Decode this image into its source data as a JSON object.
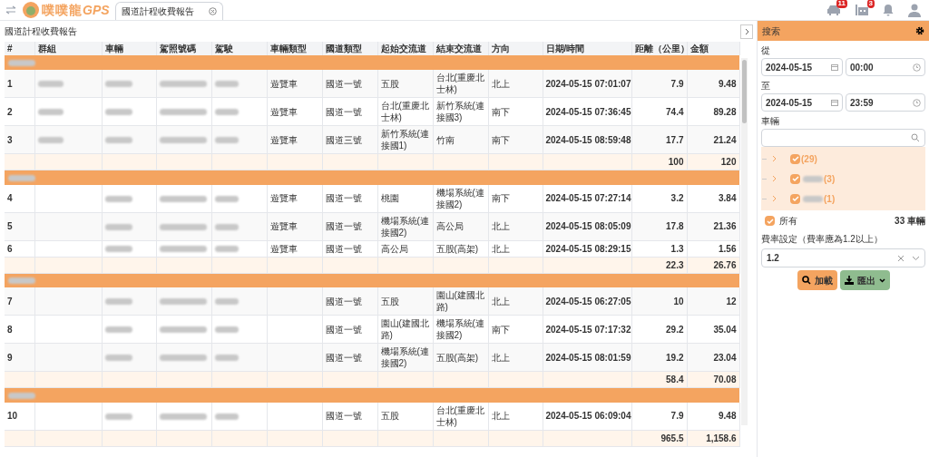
{
  "top_bar": {
    "brand": "噗噗龍",
    "brand_suffix": "GPS",
    "tabs": [
      {
        "label": "國道計程收費報告",
        "selected": true,
        "closable": true
      }
    ],
    "badges": [
      {
        "kind": "car",
        "count": "11"
      },
      {
        "kind": "route",
        "count": "3"
      },
      {
        "kind": "bell"
      },
      {
        "kind": "user"
      }
    ]
  },
  "page_title": "國道計程收費報告",
  "table": {
    "columns": [
      "#",
      "群組",
      "車輛",
      "駕照號碼",
      "駕駛",
      "車輛類型",
      "國道類型",
      "起始交流道",
      "結束交流道",
      "方向",
      "日期/時間",
      "距離（公里）",
      "金額"
    ],
    "groups": [
      {
        "rows": [
          {
            "no": "1",
            "blur": {
              "group": true,
              "vehicle": true,
              "license": true,
              "driver": true
            },
            "vehicle_type": "遊覽車",
            "highway": "國道一號",
            "from": "五股",
            "to": "台北(重慶北士林)",
            "direction": "北上",
            "time": "2024-05-15 07:01:07",
            "distance": "7.9",
            "amount": "9.48"
          },
          {
            "no": "2",
            "blur": {
              "group": true,
              "vehicle": true,
              "license": true,
              "driver": true
            },
            "vehicle_type": "遊覽車",
            "highway": "國道一號",
            "from": "台北(重慶北士林)",
            "to": "新竹系統(連接國3)",
            "direction": "南下",
            "time": "2024-05-15 07:36:45",
            "distance": "74.4",
            "amount": "89.28"
          },
          {
            "no": "3",
            "blur": {
              "group": true,
              "vehicle": true,
              "license": true,
              "driver": true
            },
            "vehicle_type": "遊覽車",
            "highway": "國道三號",
            "from": "新竹系統(連接國1)",
            "to": "竹南",
            "direction": "南下",
            "time": "2024-05-15 08:59:48",
            "distance": "17.7",
            "amount": "21.24"
          }
        ],
        "subtotal": {
          "distance": "100",
          "amount": "120"
        }
      },
      {
        "rows": [
          {
            "no": "4",
            "blur": {
              "group": false,
              "vehicle": true,
              "license": true,
              "driver": true
            },
            "vehicle_type": "遊覽車",
            "highway": "國道一號",
            "from": "桃園",
            "to": "機場系統(連接國2)",
            "direction": "南下",
            "time": "2024-05-15 07:27:14",
            "distance": "3.2",
            "amount": "3.84"
          },
          {
            "no": "5",
            "blur": {
              "group": false,
              "vehicle": true,
              "license": true,
              "driver": true
            },
            "vehicle_type": "遊覽車",
            "highway": "國道一號",
            "from": "機場系統(連接國2)",
            "to": "高公局",
            "direction": "北上",
            "time": "2024-05-15 08:05:09",
            "distance": "17.8",
            "amount": "21.36"
          },
          {
            "no": "6",
            "blur": {
              "group": false,
              "vehicle": true,
              "license": true,
              "driver": true
            },
            "vehicle_type": "遊覽車",
            "highway": "國道一號",
            "from": "高公局",
            "to": "五股(高架)",
            "direction": "北上",
            "time": "2024-05-15 08:29:15",
            "distance": "1.3",
            "amount": "1.56"
          }
        ],
        "subtotal": {
          "distance": "22.3",
          "amount": "26.76"
        }
      },
      {
        "rows": [
          {
            "no": "7",
            "blur": {
              "group": false,
              "vehicle": true,
              "license": true,
              "driver": true
            },
            "highway": "國道一號",
            "from": "五股",
            "to": "園山(建國北路)",
            "direction": "北上",
            "time": "2024-05-15 06:27:05",
            "distance": "10",
            "amount": "12"
          },
          {
            "no": "8",
            "blur": {
              "group": false,
              "vehicle": true,
              "license": true,
              "driver": true
            },
            "highway": "國道一號",
            "from": "園山(建國北路)",
            "to": "機場系統(連接國2)",
            "direction": "南下",
            "time": "2024-05-15 07:17:32",
            "distance": "29.2",
            "amount": "35.04"
          },
          {
            "no": "9",
            "blur": {
              "group": false,
              "vehicle": true,
              "license": true,
              "driver": true
            },
            "highway": "國道一號",
            "from": "機場系統(連接國2)",
            "to": "五股(高架)",
            "direction": "北上",
            "time": "2024-05-15 08:01:59",
            "distance": "19.2",
            "amount": "23.04"
          }
        ],
        "subtotal": {
          "distance": "58.4",
          "amount": "70.08"
        }
      },
      {
        "rows": [
          {
            "no": "10",
            "blur": {
              "group": false,
              "vehicle": true,
              "license": true,
              "driver": true
            },
            "highway": "國道一號",
            "from": "五股",
            "to": "台北(重慶北士林)",
            "direction": "北上",
            "time": "2024-05-15 06:09:04",
            "distance": "7.9",
            "amount": "9.48"
          }
        ]
      }
    ],
    "total": {
      "distance": "965.5",
      "amount": "1,158.6"
    }
  },
  "search_panel": {
    "title": "搜索",
    "from_label": "從",
    "from_date": "2024-05-15",
    "from_time": "00:00",
    "to_label": "至",
    "to_date": "2024-05-15",
    "to_time": "23:59",
    "vehicle_label": "車輛",
    "tree": [
      {
        "count": "(29)",
        "name_blurred": false,
        "checked": true
      },
      {
        "count": "(3)",
        "name_blurred": true,
        "checked": true
      },
      {
        "count": "(1)",
        "name_blurred": true,
        "checked": true
      }
    ],
    "all_label": "所有",
    "all_checked": true,
    "vehicle_count": "33 車輛",
    "rate_label": "費率設定（費率應為1.2以上）",
    "rate_value": "1.2",
    "buttons": [
      {
        "kind": "load",
        "label": "加載"
      },
      {
        "kind": "export",
        "label": "匯出"
      }
    ]
  }
}
